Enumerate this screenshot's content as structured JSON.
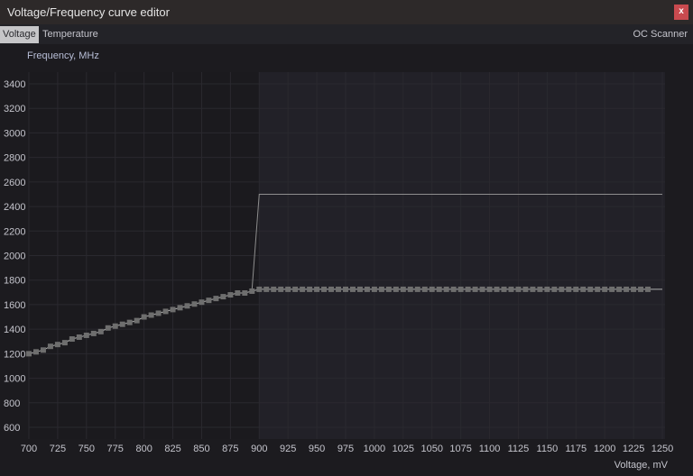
{
  "window": {
    "title": "Voltage/Frequency curve editor",
    "close_label": "x"
  },
  "tabs": [
    {
      "label": "Voltage",
      "active": true
    },
    {
      "label": "Temperature",
      "active": false
    }
  ],
  "oc_scanner_label": "OC Scanner",
  "colors": {
    "background": "#1c1b1f",
    "shaded_region": "#222128",
    "curve": "#8a8a8a",
    "marker": "#6e6e6e",
    "close": "#c94a4f"
  },
  "chart_data": {
    "type": "line",
    "ylabel": "Frequency, MHz",
    "xlabel": "Voltage, mV",
    "xlim": [
      700,
      1250
    ],
    "ylim": [
      600,
      3495
    ],
    "x_ticks": [
      700,
      725,
      750,
      775,
      800,
      825,
      850,
      875,
      900,
      925,
      950,
      975,
      1000,
      1025,
      1050,
      1075,
      1100,
      1125,
      1150,
      1175,
      1200,
      1225,
      1250
    ],
    "y_ticks": [
      600,
      800,
      1000,
      1200,
      1400,
      1600,
      1800,
      2000,
      2200,
      2400,
      2600,
      2800,
      3000,
      3200,
      3400
    ],
    "shaded_from_voltage": 900,
    "curve_points": {
      "x_start": 700,
      "x_step": 6.25,
      "values": [
        1200,
        1215,
        1230,
        1260,
        1275,
        1290,
        1320,
        1335,
        1350,
        1365,
        1380,
        1410,
        1425,
        1440,
        1455,
        1470,
        1500,
        1515,
        1530,
        1545,
        1560,
        1575,
        1590,
        1605,
        1620,
        1635,
        1650,
        1665,
        1680,
        1695,
        1695,
        1710,
        1725,
        1725,
        1725,
        1725,
        1725,
        1725,
        1725,
        1725,
        1725,
        1725,
        1725,
        1725,
        1725,
        1725,
        1725,
        1725,
        1725,
        1725,
        1725,
        1725,
        1725,
        1725,
        1725,
        1725,
        1725,
        1725,
        1725,
        1725,
        1725,
        1725,
        1725,
        1725,
        1725,
        1725,
        1725,
        1725,
        1725,
        1725,
        1725,
        1725,
        1725,
        1725,
        1725,
        1725,
        1725,
        1725,
        1725,
        1725,
        1725,
        1725,
        1725,
        1725,
        1725,
        1725,
        1725
      ]
    },
    "curve_line_end": [
      1250,
      1725
    ],
    "offset_line": [
      [
        893.75,
        1725
      ],
      [
        900,
        2500
      ],
      [
        1250,
        2500
      ]
    ],
    "grid": true
  }
}
